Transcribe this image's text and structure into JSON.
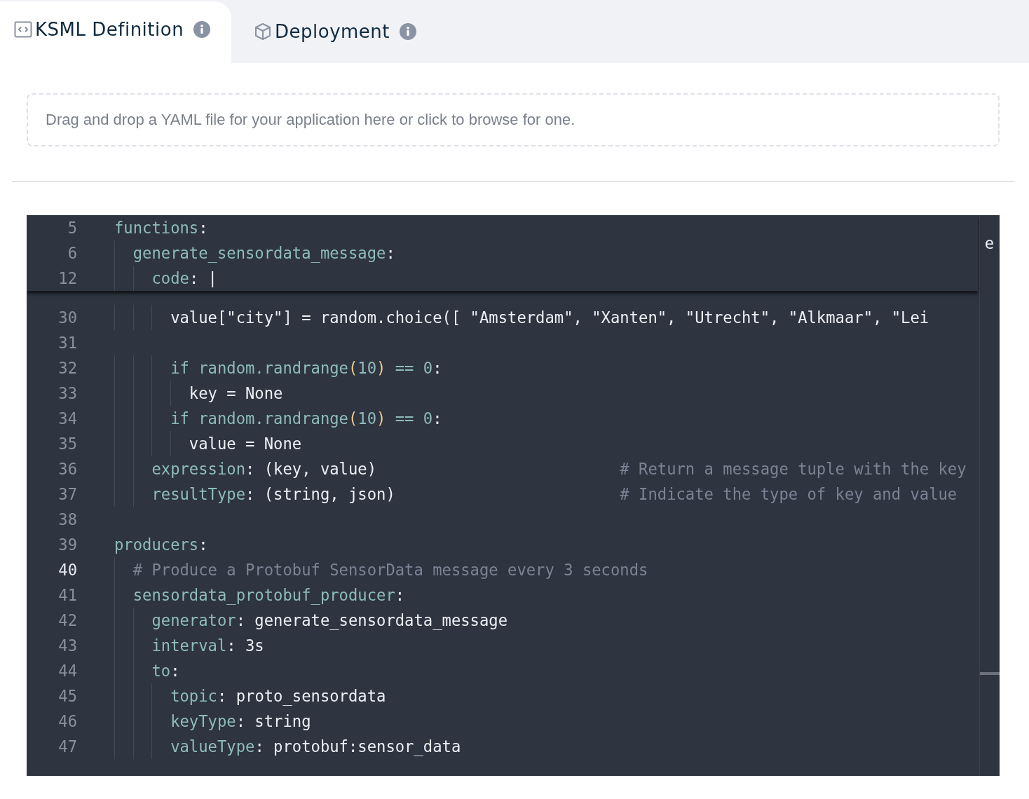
{
  "tabs": [
    {
      "label": "KSML Definition",
      "selected": true
    },
    {
      "label": "Deployment",
      "selected": false
    }
  ],
  "dropzone": {
    "text": "Drag and drop a YAML file for your application here or click to browse for one."
  },
  "editor": {
    "sticky_lines": [
      {
        "number": "5",
        "tokens": [
          {
            "kind": "key",
            "text": "functions"
          },
          {
            "kind": "plain",
            "text": ":"
          }
        ]
      },
      {
        "number": "6",
        "tokens": [
          {
            "kind": "key",
            "text": "  generate_sensordata_message"
          },
          {
            "kind": "plain",
            "text": ":"
          }
        ]
      },
      {
        "number": "12",
        "tokens": [
          {
            "kind": "key",
            "text": "    code"
          },
          {
            "kind": "plain",
            "text": ": |"
          }
        ]
      }
    ],
    "overflow_fragment": "e",
    "lines": [
      {
        "number": "30",
        "active": false,
        "tokens": [
          {
            "kind": "plain",
            "text": "      value[\"city\"] = random.choice([ \"Amsterdam\", \"Xanten\", \"Utrecht\", \"Alkmaar\", \"Lei"
          }
        ]
      },
      {
        "number": "31",
        "active": false
      },
      {
        "number": "32",
        "active": false,
        "tokens": [
          {
            "kind": "key",
            "text": "      if random.randrange"
          },
          {
            "kind": "paren",
            "text": "("
          },
          {
            "kind": "key",
            "text": "10"
          },
          {
            "kind": "paren",
            "text": ")"
          },
          {
            "kind": "key",
            "text": " == 0"
          },
          {
            "kind": "plain",
            "text": ":"
          }
        ]
      },
      {
        "number": "33",
        "active": false,
        "tokens": [
          {
            "kind": "plain",
            "text": "        key = None"
          }
        ]
      },
      {
        "number": "34",
        "active": false,
        "tokens": [
          {
            "kind": "key",
            "text": "      if random.randrange"
          },
          {
            "kind": "paren",
            "text": "("
          },
          {
            "kind": "key",
            "text": "10"
          },
          {
            "kind": "paren",
            "text": ")"
          },
          {
            "kind": "key",
            "text": " == 0"
          },
          {
            "kind": "plain",
            "text": ":"
          }
        ]
      },
      {
        "number": "35",
        "active": false,
        "tokens": [
          {
            "kind": "plain",
            "text": "        value = None"
          }
        ]
      },
      {
        "number": "36",
        "active": false,
        "tokens": [
          {
            "kind": "key",
            "text": "    expression"
          },
          {
            "kind": "plain",
            "text": ": (key, value)                          "
          },
          {
            "kind": "comment",
            "text": "# Return a message tuple with the key"
          }
        ]
      },
      {
        "number": "37",
        "active": false,
        "tokens": [
          {
            "kind": "key",
            "text": "    resultType"
          },
          {
            "kind": "plain",
            "text": ": (string, json)                        "
          },
          {
            "kind": "comment",
            "text": "# Indicate the type of key and value"
          }
        ]
      },
      {
        "number": "38",
        "active": false
      },
      {
        "number": "39",
        "active": false,
        "tokens": [
          {
            "kind": "key",
            "text": "producers"
          },
          {
            "kind": "plain",
            "text": ":"
          }
        ]
      },
      {
        "number": "40",
        "active": true,
        "tokens": [
          {
            "kind": "comment",
            "text": "  # Produce a Protobuf SensorData message every 3 seconds"
          }
        ]
      },
      {
        "number": "41",
        "active": false,
        "tokens": [
          {
            "kind": "key",
            "text": "  sensordata_protobuf_producer"
          },
          {
            "kind": "plain",
            "text": ":"
          }
        ]
      },
      {
        "number": "42",
        "active": false,
        "tokens": [
          {
            "kind": "key",
            "text": "    generator"
          },
          {
            "kind": "plain",
            "text": ": generate_sensordata_message"
          }
        ]
      },
      {
        "number": "43",
        "active": false,
        "tokens": [
          {
            "kind": "key",
            "text": "    interval"
          },
          {
            "kind": "plain",
            "text": ": 3s"
          }
        ]
      },
      {
        "number": "44",
        "active": false,
        "tokens": [
          {
            "kind": "key",
            "text": "    to"
          },
          {
            "kind": "plain",
            "text": ":"
          }
        ]
      },
      {
        "number": "45",
        "active": false,
        "tokens": [
          {
            "kind": "key",
            "text": "      topic"
          },
          {
            "kind": "plain",
            "text": ": proto_sensordata"
          }
        ]
      },
      {
        "number": "46",
        "active": false,
        "tokens": [
          {
            "kind": "key",
            "text": "      keyType"
          },
          {
            "kind": "plain",
            "text": ": string"
          }
        ]
      },
      {
        "number": "47",
        "active": false,
        "tokens": [
          {
            "kind": "key",
            "text": "      valueType"
          },
          {
            "kind": "plain",
            "text": ": protobuf:sensor_data"
          }
        ]
      }
    ]
  }
}
